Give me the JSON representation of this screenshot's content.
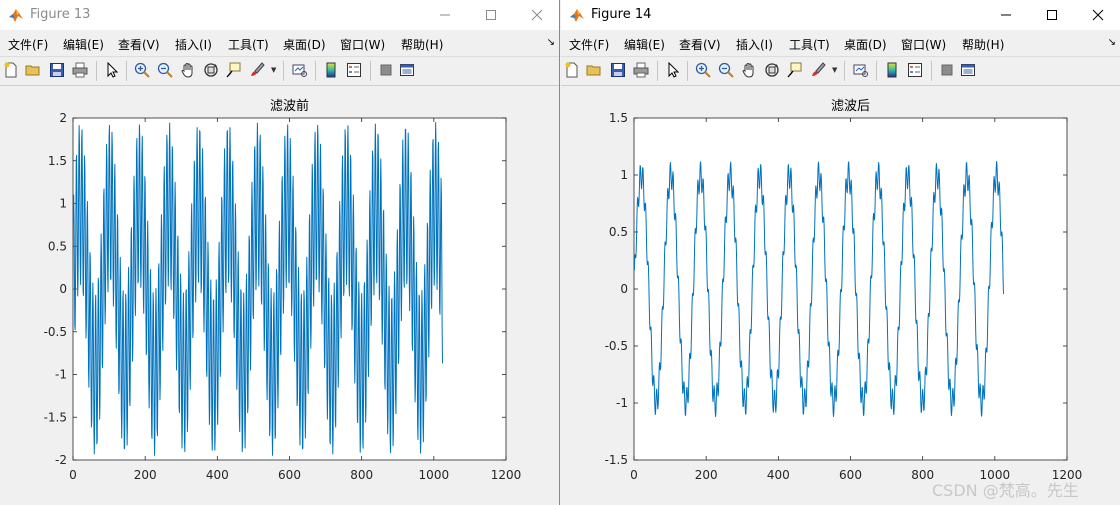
{
  "windows": [
    {
      "title": "Figure 13",
      "active": false,
      "menu": [
        "文件(F)",
        "编辑(E)",
        "查看(V)",
        "插入(I)",
        "工具(T)",
        "桌面(D)",
        "窗口(W)",
        "帮助(H)"
      ],
      "chart_data": {
        "type": "line",
        "title": "滤波前",
        "xlabel": "",
        "ylabel": "",
        "xlim": [
          0,
          1200
        ],
        "ylim": [
          -2,
          2
        ],
        "xticks": [
          0,
          200,
          400,
          600,
          800,
          1000,
          1200
        ],
        "yticks": [
          -2,
          -1.5,
          -1,
          -0.5,
          0,
          0.5,
          1,
          1.5,
          2
        ],
        "xtick_labels": [
          "0",
          "200",
          "400",
          "600",
          "800",
          "1000",
          "1200"
        ],
        "ytick_labels": [
          "-2",
          "-1.5",
          "-1",
          "-0.5",
          "0",
          "0.5",
          "1",
          "1.5",
          "2"
        ],
        "grid": false,
        "color": "#0072bd",
        "series": [
          {
            "signal": "sin(2π·x/82) + 0.95·sin(2π·x/7.6)",
            "x_range": [
              1,
              1024
            ],
            "samples": 1024
          }
        ]
      }
    },
    {
      "title": "Figure 14",
      "active": true,
      "menu": [
        "文件(F)",
        "编辑(E)",
        "查看(V)",
        "插入(I)",
        "工具(T)",
        "桌面(D)",
        "窗口(W)",
        "帮助(H)"
      ],
      "chart_data": {
        "type": "line",
        "title": "滤波后",
        "xlabel": "",
        "ylabel": "",
        "xlim": [
          0,
          1200
        ],
        "ylim": [
          -1.5,
          1.5
        ],
        "xticks": [
          0,
          200,
          400,
          600,
          800,
          1000,
          1200
        ],
        "yticks": [
          -1.5,
          -1,
          -0.5,
          0,
          0.5,
          1,
          1.5
        ],
        "xtick_labels": [
          "0",
          "200",
          "400",
          "600",
          "800",
          "1000",
          "1200"
        ],
        "ytick_labels": [
          "-1.5",
          "-1",
          "-0.5",
          "0",
          "0.5",
          "1",
          "1.5"
        ],
        "grid": false,
        "color": "#0072bd",
        "series": [
          {
            "signal": "sin(2π·x/82) + 0.12·sin(2π·x/7.6)",
            "x_range": [
              1,
              1024
            ],
            "samples": 1024
          }
        ]
      }
    }
  ],
  "toolbar_icons": [
    "new-file-icon",
    "open-folder-icon",
    "save-icon",
    "print-icon",
    "pointer-icon",
    "zoom-in-icon",
    "zoom-out-icon",
    "pan-hand-icon",
    "rotate-3d-icon",
    "data-cursor-icon",
    "brush-icon",
    "link-plot-icon",
    "colorbar-icon",
    "legend-icon",
    "hide-plot-tools-icon",
    "show-plot-tools-icon"
  ],
  "watermark": "CSDN @梵高。先生"
}
